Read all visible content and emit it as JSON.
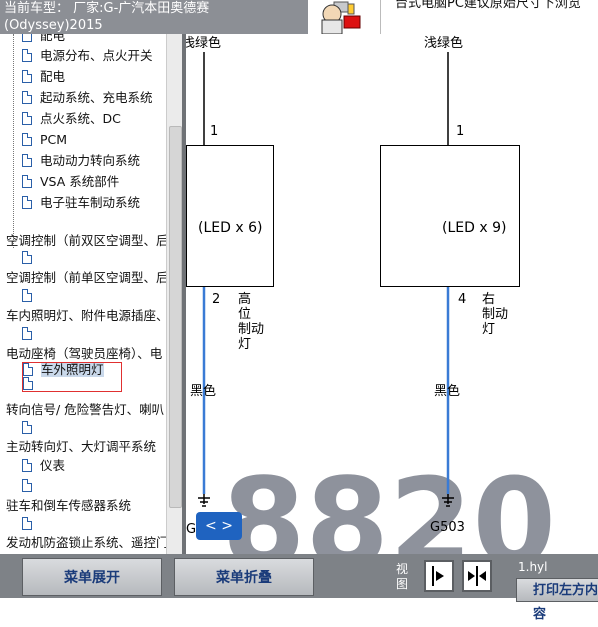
{
  "header": {
    "title_line1": "当前车型： 厂家:G-广汽本田奥德赛",
    "title_line2": "(Odyssey)2015",
    "note": "台式电脑PC建议原始尺寸下浏览"
  },
  "tree": {
    "items": [
      {
        "label": "配电"
      },
      {
        "label": "电源分布、点火开关"
      },
      {
        "label": "配电"
      },
      {
        "label": "起动系统、充电系统"
      },
      {
        "label": "点火系统、DC"
      },
      {
        "label": "PCM"
      },
      {
        "label": "电动动力转向系统"
      },
      {
        "label": "VSA 系统部件"
      },
      {
        "label": "电子驻车制动系统"
      },
      {
        "label": "空调控制（前双区空调型、后"
      },
      {
        "label": "空调控制（前单区空调型、后"
      },
      {
        "label": "车内照明灯、附件电源插座、"
      },
      {
        "label": "电动座椅（驾驶员座椅）、电"
      },
      {
        "label": "车外照明灯"
      },
      {
        "label": "转向信号/ 危险警告灯、喇叭"
      },
      {
        "label": "主动转向灯、大灯调平系统"
      },
      {
        "label": "仪表"
      },
      {
        "label": "驻车和倒车传感器系统"
      },
      {
        "label": "发动机防盗锁止系统、遥控门"
      }
    ]
  },
  "diagram": {
    "left": {
      "wire_top": "浅绿色",
      "pin_top": "1",
      "led": "(LED x 6)",
      "pin_bottom": "2",
      "name": [
        "高",
        "位",
        "制动",
        "灯"
      ],
      "wire_bottom": "黑色",
      "ground": "G"
    },
    "right": {
      "wire_top": "浅绿色",
      "pin_top": "1",
      "led": "(LED x 9)",
      "pin_bottom": "4",
      "name": [
        "右",
        "制动",
        "灯"
      ],
      "wire_bottom": "黑色",
      "ground": "G503"
    },
    "watermark": "8820"
  },
  "nav_button": {
    "label": "< >"
  },
  "bottom": {
    "expand_label": "菜单展开",
    "collapse_label": "菜单折叠",
    "view_label": "视图",
    "file_label": "1.hyl",
    "print_label": "打印左方内容"
  },
  "colors": {
    "header_bg": "#8c8f95",
    "toolbar_bg": "#7e8287",
    "wire_blue": "#3a7bd5",
    "selection_border": "#e03030",
    "nav_button": "#1f63c0"
  }
}
